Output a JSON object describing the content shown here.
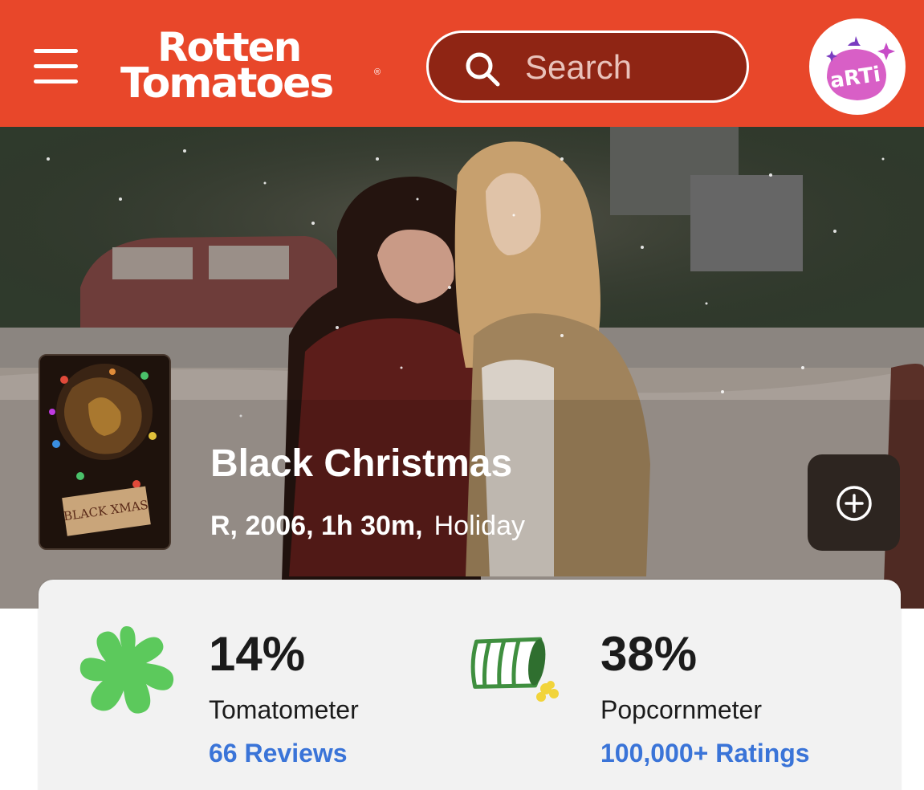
{
  "header": {
    "logo_line1": "Rotten",
    "logo_line2": "Tomatoes",
    "logo_reg": "®",
    "search_placeholder": "Search",
    "avatar_text": "aRTi"
  },
  "movie": {
    "title": "Black Christmas",
    "meta_bold": "R, 2006, 1h 30m,",
    "genre": "Holiday",
    "poster_text": "BLACK XMAS"
  },
  "scores": {
    "tomatometer": {
      "value": "14%",
      "label": "Tomatometer",
      "link": "66 Reviews"
    },
    "popcornmeter": {
      "value": "38%",
      "label": "Popcornmeter",
      "link": "100,000+ Ratings"
    }
  },
  "colors": {
    "brand": "#e8472a",
    "search_bg": "#8f2514",
    "link": "#3a74d8",
    "splat": "#5cc95c",
    "popcorn_bucket": "#3f8f3f"
  },
  "icons": [
    "menu-icon",
    "search-icon",
    "arti-avatar-icon",
    "add-watchlist-icon",
    "rotten-splat-icon",
    "spilled-popcorn-icon"
  ]
}
